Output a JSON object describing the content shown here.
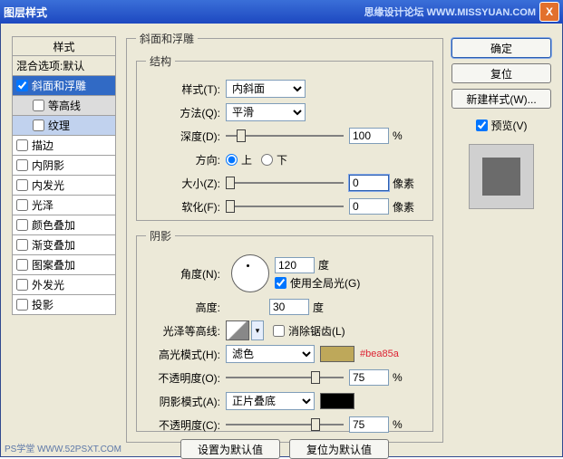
{
  "titlebar": {
    "title": "图层样式",
    "credits": "思缘设计论坛  WWW.MISSYUAN.COM",
    "close": "X"
  },
  "styles_panel": {
    "header": "样式",
    "blend_options": "混合选项:默认",
    "items": [
      {
        "label": "斜面和浮雕",
        "checked": true,
        "selected": true
      },
      {
        "label": "等高线",
        "checked": false,
        "sub": true
      },
      {
        "label": "纹理",
        "checked": false,
        "sub": true,
        "subsel": true
      },
      {
        "label": "描边",
        "checked": false
      },
      {
        "label": "内阴影",
        "checked": false
      },
      {
        "label": "内发光",
        "checked": false
      },
      {
        "label": "光泽",
        "checked": false
      },
      {
        "label": "颜色叠加",
        "checked": false
      },
      {
        "label": "渐变叠加",
        "checked": false
      },
      {
        "label": "图案叠加",
        "checked": false
      },
      {
        "label": "外发光",
        "checked": false
      },
      {
        "label": "投影",
        "checked": false
      }
    ]
  },
  "bevel": {
    "legend": "斜面和浮雕",
    "structure": {
      "legend": "结构",
      "style_label": "样式(T):",
      "style_value": "内斜面",
      "technique_label": "方法(Q):",
      "technique_value": "平滑",
      "depth_label": "深度(D):",
      "depth_value": "100",
      "depth_unit": "%",
      "direction_label": "方向:",
      "up": "上",
      "down": "下",
      "size_label": "大小(Z):",
      "size_value": "0",
      "size_unit": "像素",
      "soften_label": "软化(F):",
      "soften_value": "0",
      "soften_unit": "像素"
    },
    "shading": {
      "legend": "阴影",
      "angle_label": "角度(N):",
      "angle_value": "120",
      "angle_unit": "度",
      "global_light": "使用全局光(G)",
      "altitude_label": "高度:",
      "altitude_value": "30",
      "altitude_unit": "度",
      "gloss_label": "光泽等高线:",
      "antialias": "消除锯齿(L)",
      "highlight_mode_label": "高光模式(H):",
      "highlight_mode_value": "滤色",
      "highlight_color": "#bea85a",
      "highlight_annot": "#bea85a",
      "highlight_opacity_label": "不透明度(O):",
      "highlight_opacity_value": "75",
      "pct": "%",
      "shadow_mode_label": "阴影模式(A):",
      "shadow_mode_value": "正片叠底",
      "shadow_color": "#000000",
      "shadow_opacity_label": "不透明度(C):",
      "shadow_opacity_value": "75"
    },
    "make_default": "设置为默认值",
    "reset_default": "复位为默认值"
  },
  "buttons": {
    "ok": "确定",
    "cancel": "复位",
    "new_style": "新建样式(W)...",
    "preview": "预览(V)"
  },
  "footer": "PS学堂  WWW.52PSXT.COM"
}
